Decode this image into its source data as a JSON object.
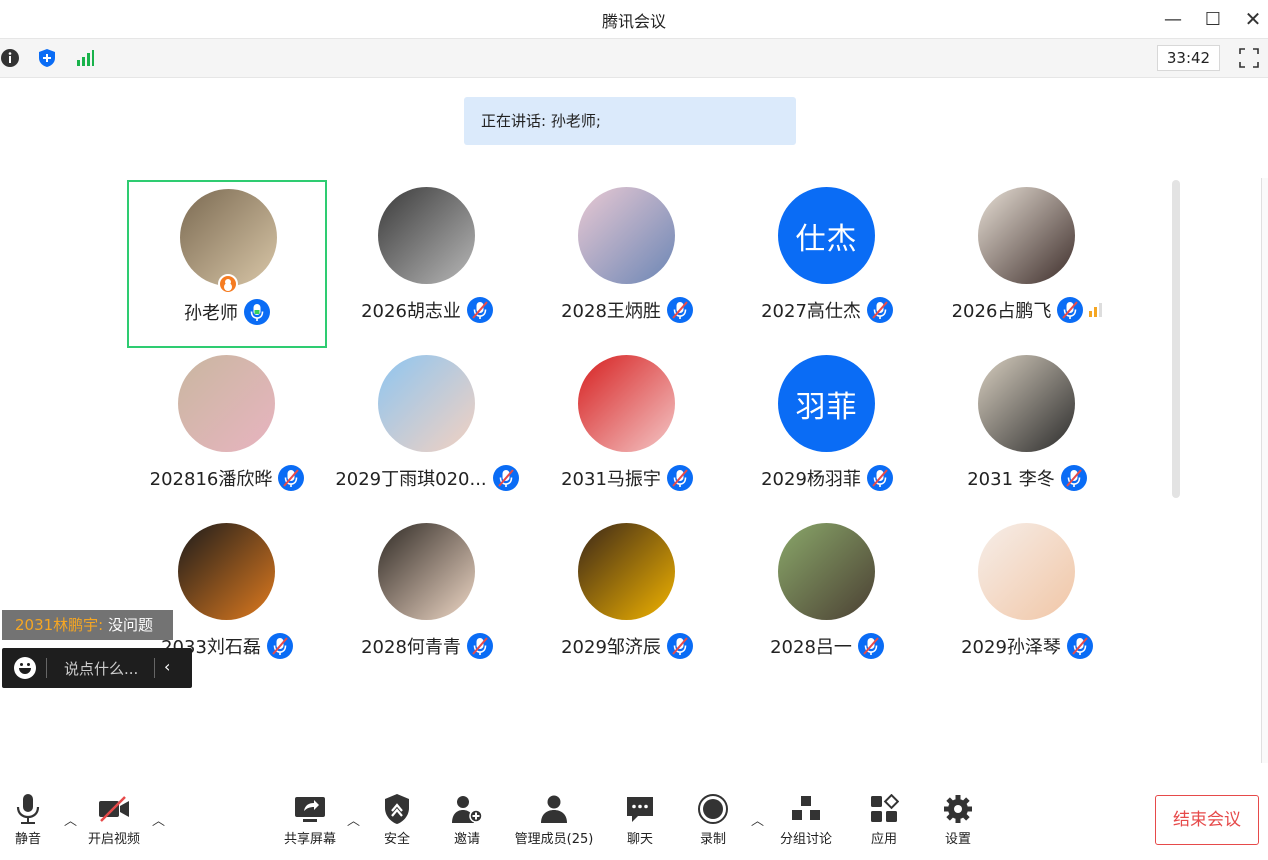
{
  "window": {
    "title": "腾讯会议",
    "timer": "33:42"
  },
  "speaking_banner": "正在讲话: 孙老师;",
  "participants": [
    {
      "name": "孙老师",
      "avatar": "photo",
      "colors": [
        "#7b6a52",
        "#d9c7a8"
      ],
      "active": true,
      "host": true,
      "mic": "speaking"
    },
    {
      "name": "2026胡志业",
      "avatar": "photo",
      "colors": [
        "#3a3a3a",
        "#b8b8b8"
      ],
      "mic": "muted"
    },
    {
      "name": "2028王炳胜",
      "avatar": "photo",
      "colors": [
        "#e9c9d3",
        "#6b86b5"
      ],
      "mic": "muted"
    },
    {
      "name": "2027高仕杰",
      "avatar": "text",
      "avatar_text": "仕杰",
      "mic": "muted"
    },
    {
      "name": "2026占鹏飞",
      "avatar": "photo",
      "colors": [
        "#e8e0d6",
        "#3d2d2a"
      ],
      "mic": "muted",
      "signal": true
    },
    {
      "name": "202816潘欣晔",
      "avatar": "photo",
      "colors": [
        "#c9b7a0",
        "#e8b4c0"
      ],
      "mic": "muted"
    },
    {
      "name": "2029丁雨琪020...",
      "avatar": "photo",
      "colors": [
        "#8ec5f0",
        "#f3d1c1"
      ],
      "mic": "muted"
    },
    {
      "name": "2031马振宇",
      "avatar": "photo",
      "colors": [
        "#d62020",
        "#f4c7c7"
      ],
      "mic": "muted"
    },
    {
      "name": "2029杨羽菲",
      "avatar": "text",
      "avatar_text": "羽菲",
      "mic": "muted"
    },
    {
      "name": "2031 李冬",
      "avatar": "photo",
      "colors": [
        "#d8cfc0",
        "#2b2b2b"
      ],
      "mic": "muted"
    },
    {
      "name": "2033刘石磊",
      "avatar": "photo",
      "colors": [
        "#1b1b1b",
        "#e07b1f"
      ],
      "mic": "muted"
    },
    {
      "name": "2028何青青",
      "avatar": "photo",
      "colors": [
        "#2f2a25",
        "#f0d8c6"
      ],
      "mic": "muted"
    },
    {
      "name": "2029邹济辰",
      "avatar": "photo",
      "colors": [
        "#3a2618",
        "#f2b400"
      ],
      "mic": "muted"
    },
    {
      "name": "2028吕一",
      "avatar": "photo",
      "colors": [
        "#8aa86a",
        "#4b3f33"
      ],
      "mic": "muted"
    },
    {
      "name": "2029孙泽琴",
      "avatar": "photo",
      "colors": [
        "#f6eee9",
        "#f1c6a6"
      ],
      "mic": "muted"
    }
  ],
  "chat": {
    "sender": "2031林鹏宇:",
    "message": "没问题",
    "placeholder": "说点什么..."
  },
  "toolbar": {
    "mute": "静音",
    "video": "开启视频",
    "share": "共享屏幕",
    "security": "安全",
    "invite": "邀请",
    "members": "管理成员(25)",
    "chat": "聊天",
    "record": "录制",
    "breakout": "分组讨论",
    "apps": "应用",
    "settings": "设置",
    "end": "结束会议"
  },
  "colors": {
    "accent_blue": "#0a6cf5",
    "active_border": "#2ecc71",
    "host_badge": "#f57c22",
    "danger": "#e64a4a",
    "banner_bg": "#dbeafb"
  }
}
